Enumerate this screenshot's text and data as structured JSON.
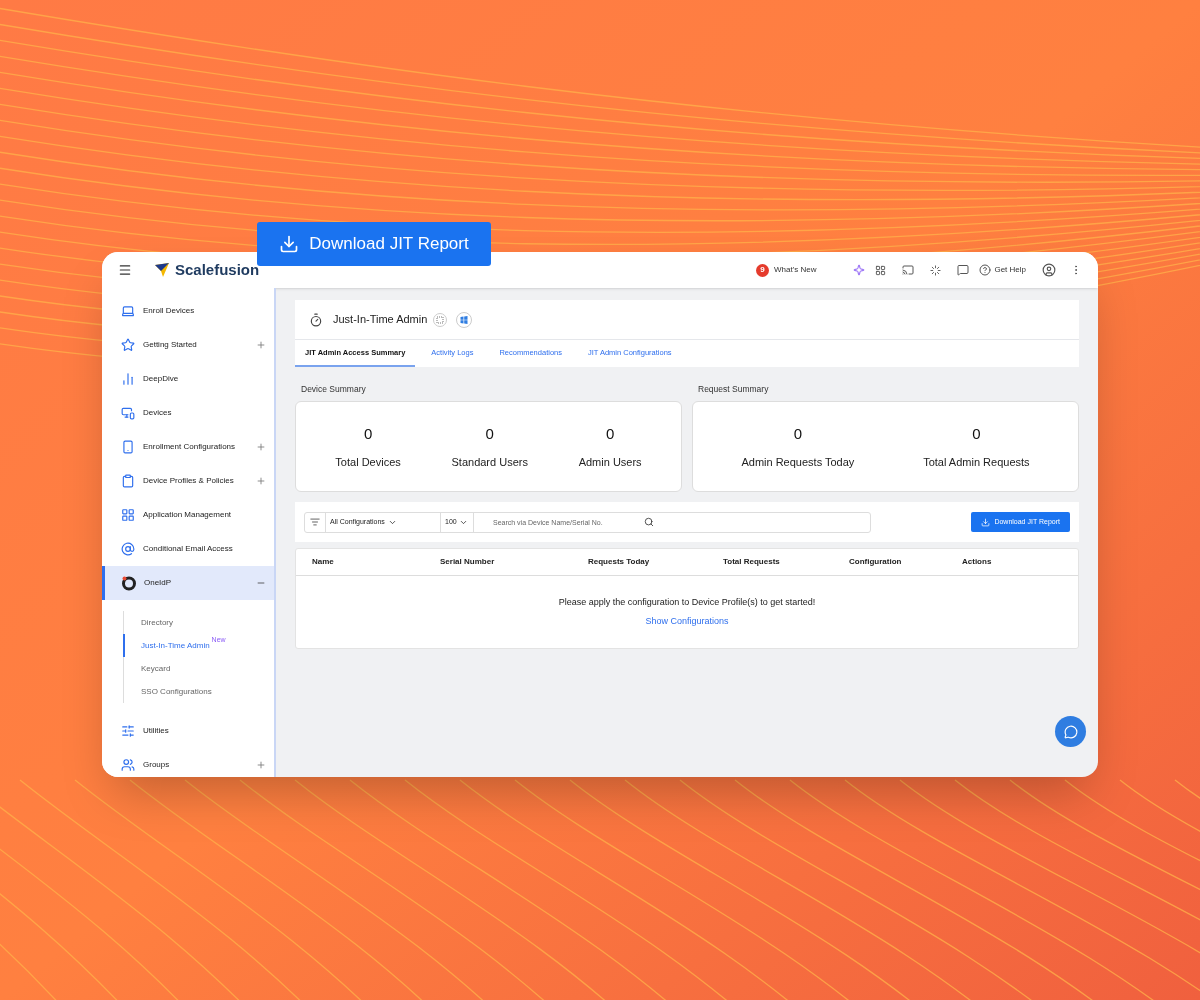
{
  "promo_button": {
    "label": "Download JIT Report"
  },
  "top_bar": {
    "brand": "Scalefusion",
    "notification_count": "9",
    "whats_new": "What's New",
    "help": "Get Help"
  },
  "sidebar": {
    "items": [
      {
        "label": "Enroll Devices",
        "selected": false
      },
      {
        "label": "Getting Started",
        "expanded": false,
        "selected": false
      },
      {
        "label": "DeepDive",
        "selected": false
      },
      {
        "label": "Devices",
        "selected": false
      },
      {
        "label": "Enrollment Configurations",
        "expanded": false,
        "selected": false
      },
      {
        "label": "Device Profiles & Policies",
        "expanded": false,
        "selected": false
      },
      {
        "label": "Application Management",
        "selected": false
      },
      {
        "label": "Conditional Email Access",
        "selected": false
      },
      {
        "label": "OneIdP",
        "expanded": true,
        "selected": true,
        "children": [
          {
            "label": "Directory",
            "selected": false
          },
          {
            "label": "Just-In-Time Admin",
            "badge": "New",
            "selected": true
          },
          {
            "label": "Keycard",
            "selected": false
          },
          {
            "label": "SSO Configurations",
            "selected": false
          }
        ]
      },
      {
        "label": "Utilities",
        "selected": false
      },
      {
        "label": "Groups",
        "expanded": false,
        "selected": false
      }
    ]
  },
  "page": {
    "title": "Just-In-Time Admin",
    "tabs": [
      {
        "label": "JIT Admin Access Summary",
        "selected": true
      },
      {
        "label": "Activity Logs",
        "selected": false
      },
      {
        "label": "Recommendations",
        "selected": false
      },
      {
        "label": "JIT Admin Configurations",
        "selected": false
      }
    ]
  },
  "summaries": [
    {
      "title": "Device Summary",
      "stats": [
        {
          "value": "0",
          "label": "Total Devices"
        },
        {
          "value": "0",
          "label": "Standard Users"
        },
        {
          "value": "0",
          "label": "Admin Users"
        }
      ]
    },
    {
      "title": "Request Summary",
      "stats": [
        {
          "value": "0",
          "label": "Admin Requests Today"
        },
        {
          "value": "0",
          "label": "Total Admin Requests"
        }
      ]
    }
  ],
  "toolbar": {
    "filter": "All Configurations",
    "page_size": "100",
    "search_placeholder": "Search via Device Name/Serial No.",
    "download": "Download JIT Report"
  },
  "table": {
    "columns": [
      "Name",
      "Serial Number",
      "Requests Today",
      "Total Requests",
      "Configuration",
      "Actions"
    ],
    "empty_message": "Please apply the configuration to Device Profile(s) to get started!",
    "empty_link": "Show Configurations"
  }
}
